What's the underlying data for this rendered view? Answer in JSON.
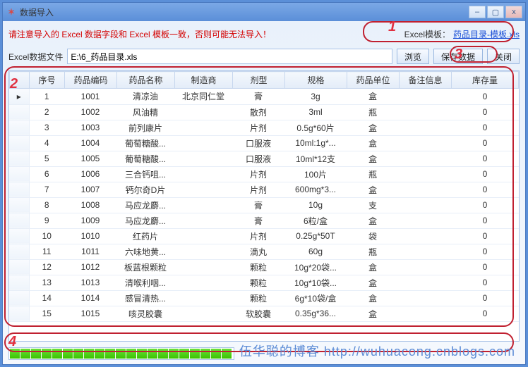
{
  "window": {
    "title": "数据导入"
  },
  "warning": "请注意导入的 Excel 数据字段和 Excel 模板一致，否则可能无法导入！",
  "templateLabel": "Excel模板：",
  "templateLink": "药品目录-模板.xls",
  "pathLabel": "Excel数据文件",
  "pathValue": "E:\\6_药品目录.xls",
  "buttons": {
    "browse": "浏览",
    "save": "保存数据",
    "close": "关闭"
  },
  "columns": [
    "",
    "序号",
    "药品编码",
    "药品名称",
    "制造商",
    "剂型",
    "规格",
    "药品单位",
    "备注信息",
    "库存量"
  ],
  "rows": [
    {
      "no": "1",
      "code": "1001",
      "name": "清凉油",
      "maker": "北京同仁堂",
      "form": "膏",
      "spec": "3g",
      "unit": "盒",
      "note": "",
      "stock": "0"
    },
    {
      "no": "2",
      "code": "1002",
      "name": "风油精",
      "maker": "",
      "form": "散剂",
      "spec": "3ml",
      "unit": "瓶",
      "note": "",
      "stock": "0"
    },
    {
      "no": "3",
      "code": "1003",
      "name": "前列康片",
      "maker": "",
      "form": "片剂",
      "spec": "0.5g*60片",
      "unit": "盒",
      "note": "",
      "stock": "0"
    },
    {
      "no": "4",
      "code": "1004",
      "name": "葡萄糖酸...",
      "maker": "",
      "form": "口服液",
      "spec": "10ml:1g*...",
      "unit": "盒",
      "note": "",
      "stock": "0"
    },
    {
      "no": "5",
      "code": "1005",
      "name": "葡萄糖酸...",
      "maker": "",
      "form": "口服液",
      "spec": "10ml*12支",
      "unit": "盒",
      "note": "",
      "stock": "0"
    },
    {
      "no": "6",
      "code": "1006",
      "name": "三合钙咀...",
      "maker": "",
      "form": "片剂",
      "spec": "100片",
      "unit": "瓶",
      "note": "",
      "stock": "0"
    },
    {
      "no": "7",
      "code": "1007",
      "name": "钙尔奇D片",
      "maker": "",
      "form": "片剂",
      "spec": "600mg*3...",
      "unit": "盒",
      "note": "",
      "stock": "0"
    },
    {
      "no": "8",
      "code": "1008",
      "name": "马应龙麝...",
      "maker": "",
      "form": "膏",
      "spec": "10g",
      "unit": "支",
      "note": "",
      "stock": "0"
    },
    {
      "no": "9",
      "code": "1009",
      "name": "马应龙麝...",
      "maker": "",
      "form": "膏",
      "spec": "6粒/盒",
      "unit": "盒",
      "note": "",
      "stock": "0"
    },
    {
      "no": "10",
      "code": "1010",
      "name": "红药片",
      "maker": "",
      "form": "片剂",
      "spec": "0.25g*50T",
      "unit": "袋",
      "note": "",
      "stock": "0"
    },
    {
      "no": "11",
      "code": "1011",
      "name": "六味地黄...",
      "maker": "",
      "form": "滴丸",
      "spec": "60g",
      "unit": "瓶",
      "note": "",
      "stock": "0"
    },
    {
      "no": "12",
      "code": "1012",
      "name": "板蓝根颗粒",
      "maker": "",
      "form": "颗粒",
      "spec": "10g*20袋...",
      "unit": "盒",
      "note": "",
      "stock": "0"
    },
    {
      "no": "13",
      "code": "1013",
      "name": "清喉利咽...",
      "maker": "",
      "form": "颗粒",
      "spec": "10g*10袋...",
      "unit": "盒",
      "note": "",
      "stock": "0"
    },
    {
      "no": "14",
      "code": "1014",
      "name": "感冒清热...",
      "maker": "",
      "form": "颗粒",
      "spec": "6g*10袋/盒",
      "unit": "盒",
      "note": "",
      "stock": "0"
    },
    {
      "no": "15",
      "code": "1015",
      "name": "咳灵胶囊",
      "maker": "",
      "form": "软胶囊",
      "spec": "0.35g*36...",
      "unit": "盒",
      "note": "",
      "stock": "0"
    }
  ],
  "annotations": {
    "n1": "1",
    "n2": "2",
    "n3": "3",
    "n4": "4"
  },
  "watermark": "伍华聪的博客 http://wuhuacong.cnblogs.com"
}
